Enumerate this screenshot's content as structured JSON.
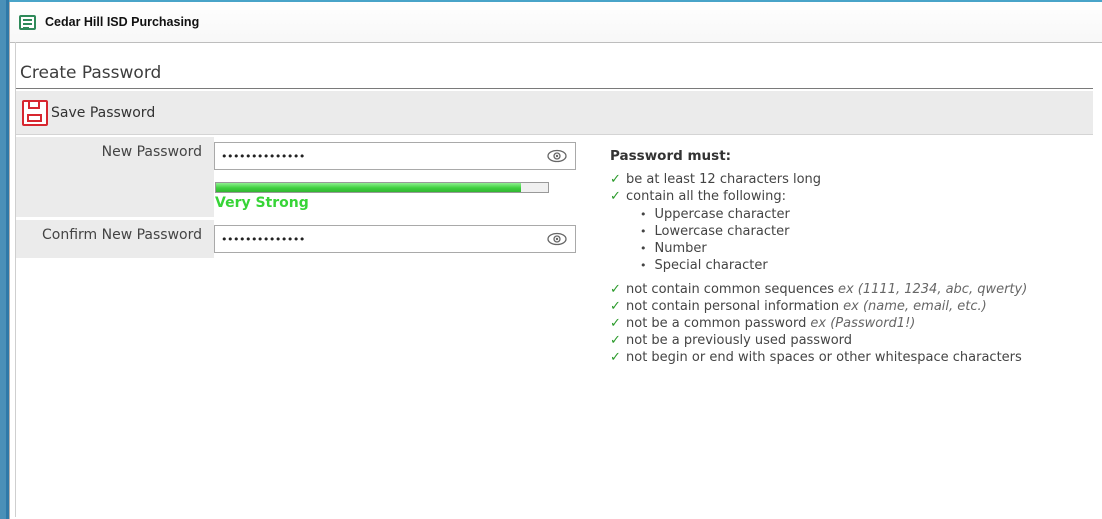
{
  "window": {
    "title": "Cedar Hill ISD Purchasing",
    "icon": "app-form-icon"
  },
  "page": {
    "title": "Create Password"
  },
  "toolbar": {
    "save_label": "Save Password",
    "save_icon": "floppy-disk-icon"
  },
  "form": {
    "new_password_label": "New Password",
    "new_password_value": "••••••••••••••",
    "confirm_password_label": "Confirm New Password",
    "confirm_password_value": "••••••••••••••",
    "strength": {
      "label": "Very Strong",
      "level_percent": 92,
      "color": "#37d437"
    }
  },
  "rules": {
    "title": "Password must:",
    "check_color": "#2a9a2a",
    "items": [
      {
        "text": "be at least 12 characters long",
        "ex": ""
      },
      {
        "text": "contain all the following:",
        "ex": ""
      }
    ],
    "sub_items": [
      "Uppercase character",
      "Lowercase character",
      "Number",
      "Special character"
    ],
    "more_items": [
      {
        "text": "not contain common sequences",
        "ex": "ex (1111, 1234, abc, qwerty)"
      },
      {
        "text": "not contain personal information",
        "ex": "ex (name, email, etc.)"
      },
      {
        "text": "not be a common password",
        "ex": "ex (Password1!)"
      },
      {
        "text": "not be a previously used password",
        "ex": ""
      },
      {
        "text": "not begin or end with spaces or other whitespace characters",
        "ex": ""
      }
    ]
  }
}
